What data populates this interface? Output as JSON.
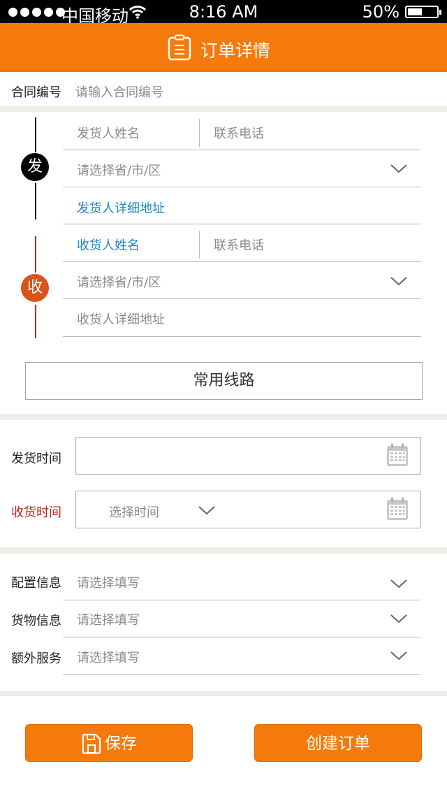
{
  "status_bar": {
    "carrier": "中国移动",
    "time": "8:16 AM",
    "battery": "50%",
    "signal_icon": "signal-dots-icon",
    "wifi_icon": "wifi-icon",
    "battery_icon": "battery-icon",
    "battery_level": 0.5
  },
  "header": {
    "title": "订单详情",
    "icon": "clipboard-icon"
  },
  "contract": {
    "label": "合同编号",
    "placeholder": "请输入合同编号"
  },
  "sender": {
    "badge": "发",
    "name_placeholder": "发货人姓名",
    "phone_placeholder": "联系电话",
    "region_placeholder": "请选择省/市/区",
    "address_placeholder": "发货人详细地址"
  },
  "receiver": {
    "badge": "收",
    "name_placeholder": "收货人姓名",
    "phone_placeholder": "联系电话",
    "region_placeholder": "请选择省/市/区",
    "address_placeholder": "收货人详细地址"
  },
  "route_button": "常用线路",
  "times": {
    "ship_label": "发货时间",
    "receive_label": "收货时间",
    "receive_placeholder": "选择时间"
  },
  "info": {
    "config_label": "配置信息",
    "cargo_label": "货物信息",
    "extra_label": "额外服务",
    "placeholder": "请选择填写"
  },
  "actions": {
    "save": "保存",
    "create": "创建订单"
  },
  "colors": {
    "accent": "#f47a0c",
    "sender_badge": "#000000",
    "receiver_badge": "#d8541a",
    "link_blue": "#1a88c8",
    "required_red": "#c0281c"
  }
}
